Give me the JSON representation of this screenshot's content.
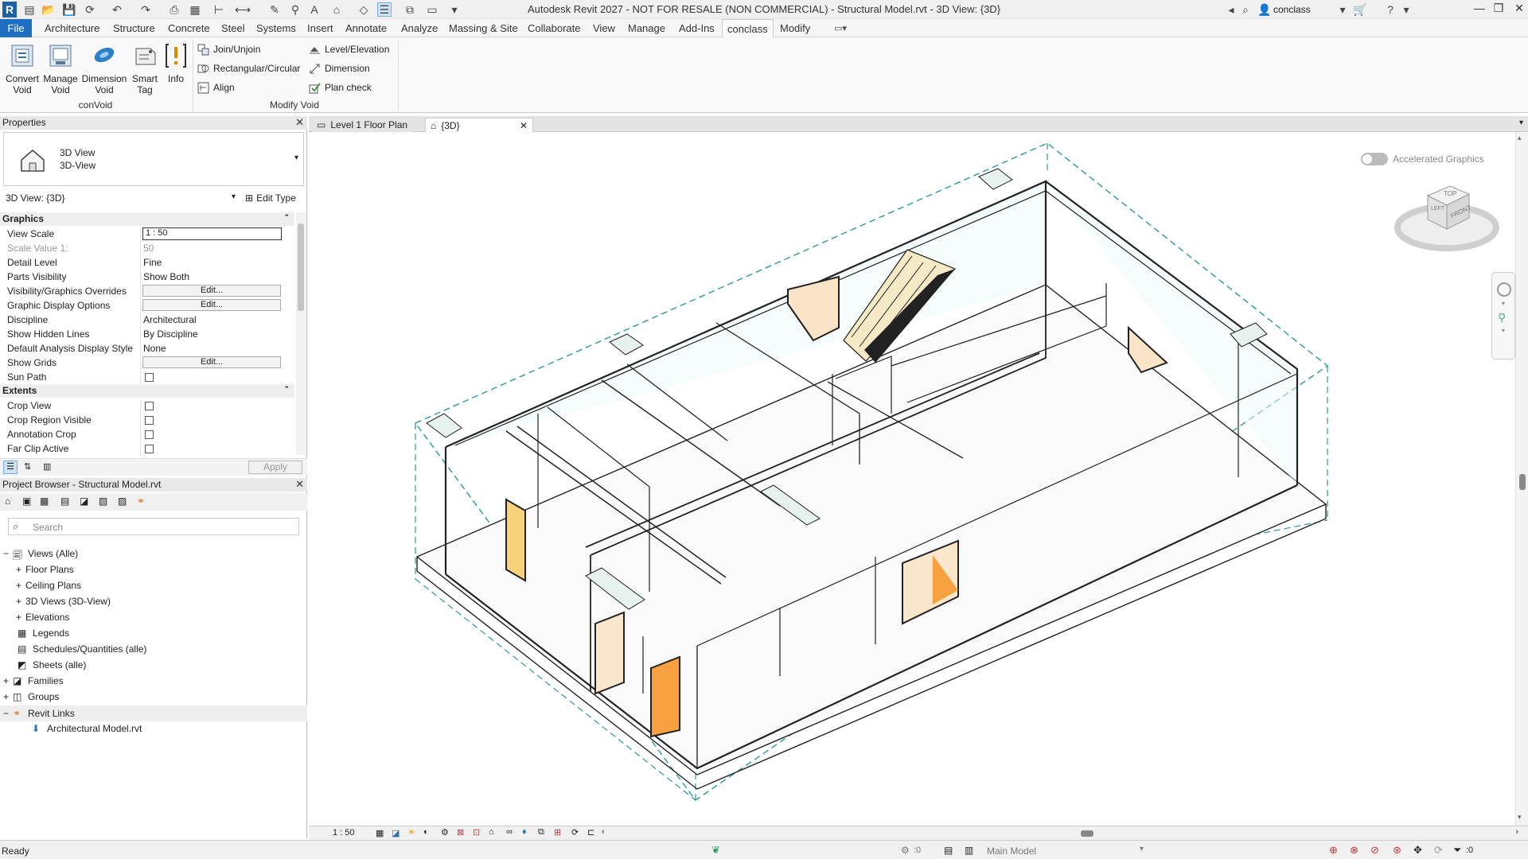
{
  "titlebar": {
    "title": "Autodesk Revit 2027 - NOT FOR RESALE (NON COMMERCIAL) - Structural Model.rvt - 3D View: {3D}",
    "user": "conclass"
  },
  "ribbon_tabs": [
    "File",
    "Architecture",
    "Structure",
    "Concrete",
    "Steel",
    "Systems",
    "Insert",
    "Annotate",
    "Analyze",
    "Massing & Site",
    "Collaborate",
    "View",
    "Manage",
    "Add-Ins",
    "conclass",
    "Modify"
  ],
  "ribbon": {
    "big_buttons": [
      {
        "line1": "Convert",
        "line2": "Void"
      },
      {
        "line1": "Manage",
        "line2": "Void"
      },
      {
        "line1": "Dimension",
        "line2": "Void"
      },
      {
        "line1": "Smart",
        "line2": "Tag"
      },
      {
        "line1": "Info",
        "line2": ""
      }
    ],
    "small_buttons": [
      "Join/Unjoin",
      "Rectangular/Circular",
      "Align",
      "Level/Elevation",
      "Dimension",
      "Plan check"
    ],
    "groups": [
      "conVoid",
      "Modify Void"
    ]
  },
  "properties": {
    "header": "Properties",
    "type_line1": "3D View",
    "type_line2": "3D-View",
    "selector": "3D View: {3D}",
    "edit_type": "Edit Type",
    "sections": {
      "graphics": "Graphics",
      "extents": "Extents"
    },
    "rows": [
      {
        "k": "View Scale",
        "v": "1 : 50"
      },
      {
        "k": "Scale Value    1:",
        "v": "50"
      },
      {
        "k": "Detail Level",
        "v": "Fine"
      },
      {
        "k": "Parts Visibility",
        "v": "Show Both"
      },
      {
        "k": "Visibility/Graphics Overrides",
        "v": "Edit..."
      },
      {
        "k": "Graphic Display Options",
        "v": "Edit..."
      },
      {
        "k": "Discipline",
        "v": "Architectural"
      },
      {
        "k": "Show Hidden Lines",
        "v": "By Discipline"
      },
      {
        "k": "Default Analysis Display Style",
        "v": "None"
      },
      {
        "k": "Show Grids",
        "v": "Edit..."
      },
      {
        "k": "Sun Path",
        "v": ""
      }
    ],
    "extent_rows": [
      "Crop View",
      "Crop Region Visible",
      "Annotation Crop",
      "Far Clip Active"
    ],
    "apply": "Apply"
  },
  "browser": {
    "header": "Project Browser - Structural Model.rvt",
    "search_placeholder": "Search",
    "items": [
      {
        "label": "Views (Alle)"
      },
      {
        "label": "Floor Plans"
      },
      {
        "label": "Ceiling Plans"
      },
      {
        "label": "3D Views (3D-View)"
      },
      {
        "label": "Elevations"
      },
      {
        "label": "Legends"
      },
      {
        "label": "Schedules/Quantities (alle)"
      },
      {
        "label": "Sheets (alle)"
      },
      {
        "label": "Families"
      },
      {
        "label": "Groups"
      },
      {
        "label": "Revit Links"
      },
      {
        "label": "Architectural Model.rvt"
      }
    ]
  },
  "view_tabs": [
    "Level 1 Floor Plan",
    "{3D}"
  ],
  "canvas": {
    "accelerated": "Accelerated Graphics",
    "cube_top": "TOP",
    "cube_front": "FRONT",
    "cube_left": "LEFT"
  },
  "viewbar": {
    "scale": "1 : 50"
  },
  "status": {
    "text": "Ready",
    "model": "Main Model",
    "sel_count": ":0",
    "filter_count": ":0"
  }
}
